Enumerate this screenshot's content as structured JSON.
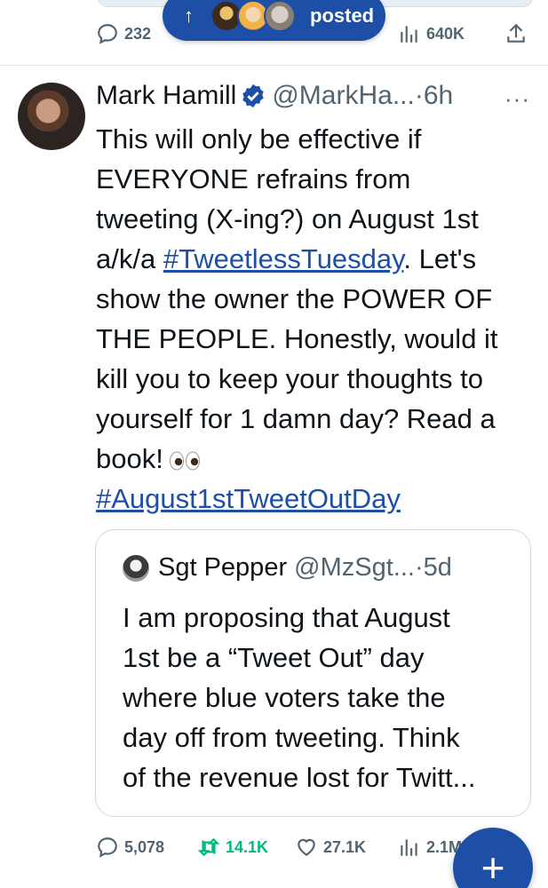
{
  "previous_tweet": {
    "actions": {
      "replies": "232",
      "views": "640K"
    }
  },
  "new_posts_pill": {
    "arrow": "↑",
    "label": "posted"
  },
  "tweet": {
    "author_name": "Mark Hamill",
    "handle": "@MarkHa...",
    "time": "·6h",
    "more": "···",
    "text_lines": [
      "This will only be effective if",
      "EVERYONE refrains from",
      "tweeting (X-ing?) on August 1st",
      "a/k/a ",
      "#TweetlessTuesday",
      ".  Let's",
      "show the owner the POWER OF",
      "THE PEOPLE. Honestly, would it",
      "kill you to keep your thoughts to",
      "yourself for 1 damn day? Read a",
      "book!",
      "#August1stTweetOutDay"
    ],
    "quote": {
      "author_name": "Sgt Pepper",
      "handle": "@MzSgt...",
      "time": "·5d",
      "lines": [
        "I am proposing that August",
        "1st be a “Tweet Out” day",
        "where blue voters take the",
        "day off from tweeting. Think",
        "of the revenue lost for Twitt..."
      ]
    },
    "actions": {
      "replies": "5,078",
      "retweets": "14.1K",
      "likes": "27.1K",
      "views": "2.1M"
    }
  },
  "fab": {
    "label": "+"
  },
  "colors": {
    "accent": "#1d4fa6",
    "retweet": "#00ba7c",
    "muted": "#536471"
  },
  "icons": [
    "reply-icon",
    "retweet-icon",
    "like-icon",
    "views-icon",
    "share-icon",
    "verified-badge-icon",
    "eyes-emoji-icon"
  ]
}
